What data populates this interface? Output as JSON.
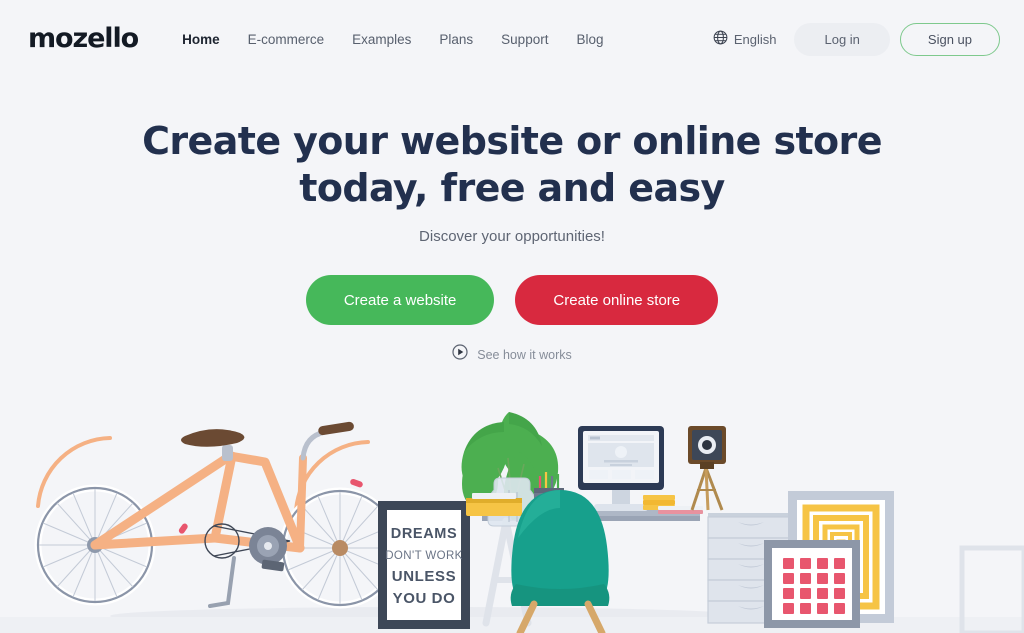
{
  "brand": {
    "logo_text": "mozello"
  },
  "nav": {
    "items": [
      {
        "label": "Home",
        "active": true
      },
      {
        "label": "E-commerce",
        "active": false
      },
      {
        "label": "Examples",
        "active": false
      },
      {
        "label": "Plans",
        "active": false
      },
      {
        "label": "Support",
        "active": false
      },
      {
        "label": "Blog",
        "active": false
      }
    ]
  },
  "header_actions": {
    "language_icon": "globe-icon",
    "language_label": "English",
    "login_label": "Log in",
    "signup_label": "Sign up"
  },
  "hero": {
    "heading_line1": "Create your website or online store",
    "heading_line2": "today, free and easy",
    "subheading": "Discover your opportunities!",
    "cta_primary": "Create a website",
    "cta_secondary": "Create online store",
    "video_icon": "play-circle-icon",
    "video_label": "See how it works"
  },
  "illustration": {
    "name": "home-office-workspace-illustration",
    "poster": {
      "line1": "DREAMS",
      "line2": "DON'T WORK",
      "line3": "UNLESS",
      "line4": "YOU DO"
    },
    "objects": [
      "bicycle",
      "motivational-poster",
      "desk",
      "monstera-plant",
      "pencil-cup",
      "yellow-tray",
      "monitor",
      "teal-chair",
      "books-stack",
      "vintage-camera-tripod",
      "drawer-cabinet",
      "yellow-framed-art",
      "pink-grid-framed-art"
    ]
  },
  "colors": {
    "page_background": "#f4f5f8",
    "heading": "#22304e",
    "cta_green": "#46b85a",
    "cta_red": "#d8293f",
    "signup_border": "#7ec98d",
    "login_background": "#eceef2",
    "muted_text": "#5e6573",
    "bike_orange": "#f5b184",
    "plant_green": "#4caf50",
    "chair_teal": "#17a08c",
    "frame_yellow": "#f6c445",
    "accent_pink": "#e8566e"
  }
}
